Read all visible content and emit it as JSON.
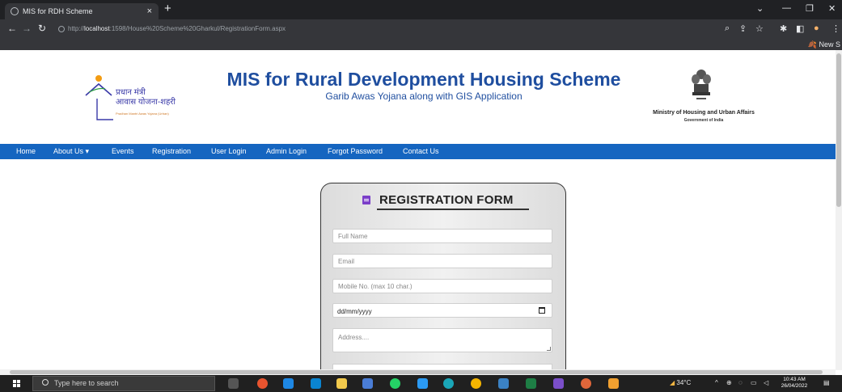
{
  "browser": {
    "tab_title": "MIS for RDH Scheme",
    "tab_close": "×",
    "new_tab": "+",
    "url_prefix": "http://",
    "url_host": "localhost",
    "url_rest": ":1598/House%20Scheme%20Gharkul/RegistrationForm.aspx",
    "bookmark": "New S"
  },
  "header": {
    "logo_line1": "प्रधान मंत्री",
    "logo_line2": "आवास योजना-शहरी",
    "logo_small": "Pradhan Mantri Awas Yojana (Urban)",
    "title": "MIS for Rural Development Housing Scheme",
    "subtitle": "Garib Awas Yojana along with GIS Application",
    "ministry": "Ministry of Housing and Urban Affairs",
    "government": "Government of India"
  },
  "nav": {
    "items": [
      "Home",
      "About Us ▾",
      "Events",
      "Registration",
      "User Login",
      "Admin Login",
      "Forgot Password",
      "Contact Us"
    ]
  },
  "form": {
    "heading": "REGISTRATION FORM",
    "full_name_placeholder": "Full Name",
    "email_placeholder": "Email",
    "mobile_placeholder": "Mobile No. (max 10 char.)",
    "dob_value": "dd/mm/yyyy",
    "address_placeholder": "Address...."
  },
  "taskbar": {
    "search_placeholder": "Type here to search",
    "temperature": "34°C",
    "time": "10:43 AM",
    "date": "26/04/2022"
  },
  "colors": {
    "nav_bg": "#1565c0",
    "title": "#1f4e9f",
    "form_icon": "#7b3fc9"
  }
}
